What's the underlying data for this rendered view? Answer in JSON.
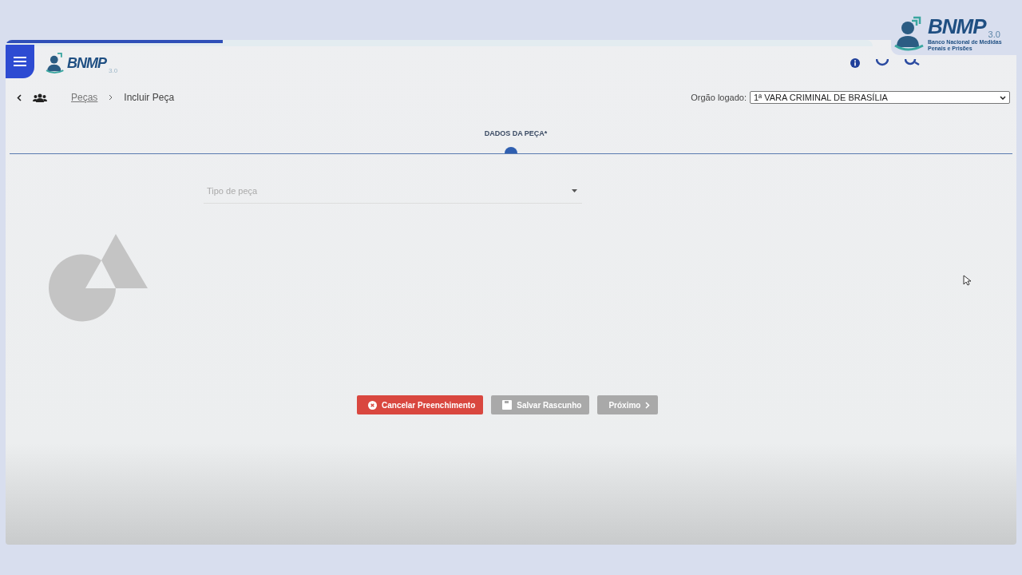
{
  "progress": {
    "level": 0.25
  },
  "header": {
    "logo": {
      "text": "BNMP",
      "version": "3.0"
    }
  },
  "overlay_logo": {
    "text": "BNMP",
    "version": "3.0",
    "subtitle": "Banco Nacional de Medidas Penais e Prisões"
  },
  "breadcrumb": [
    {
      "label": "Peças",
      "link": true
    },
    {
      "label": "Incluir Peça",
      "link": false
    }
  ],
  "orgao": {
    "label": "Orgão logado:",
    "value": "1ª VARA CRIMINAL DE BRASÍLIA"
  },
  "steps": [
    {
      "label": "DADOS DA PEÇA*",
      "selected": true
    }
  ],
  "form": {
    "placeholder": "Tipo de peça"
  },
  "buttons": [
    {
      "label": "Cancelar Preenchimento",
      "kind": "cancel",
      "disabled": false
    },
    {
      "label": "Salvar Rascunho",
      "kind": "save",
      "disabled": true
    },
    {
      "label": "Próximo",
      "kind": "next",
      "disabled": true
    }
  ]
}
